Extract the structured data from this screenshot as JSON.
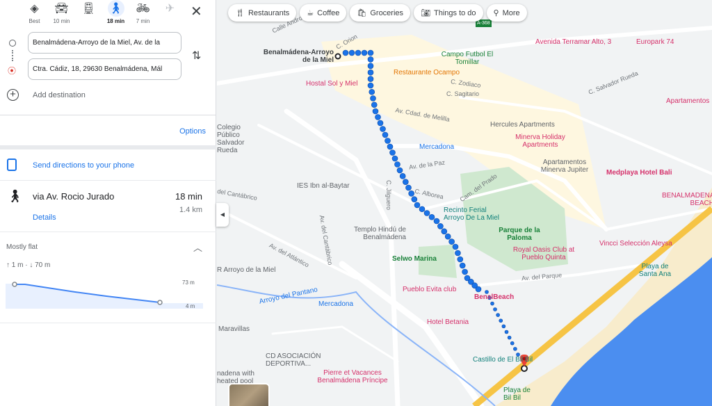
{
  "modes": [
    {
      "label": "Best",
      "icon": "directions-icon"
    },
    {
      "label": "10 min",
      "icon": "car-icon"
    },
    {
      "label": "",
      "icon": "transit-icon"
    },
    {
      "label": "18 min",
      "icon": "walk-icon",
      "active": true
    },
    {
      "label": "7 min",
      "icon": "bike-icon"
    },
    {
      "label": "",
      "icon": "flight-icon"
    }
  ],
  "origin": "Benalmádena-Arroyo de la Miel, Av. de la",
  "destination": "Ctra. Cádiz, 18, 29630 Benalmádena, Mál",
  "add_destination": "Add destination",
  "options": "Options",
  "send_phone": "Send directions to your phone",
  "route": {
    "via": "via Av. Rocio Jurado",
    "duration": "18 min",
    "distance": "1.4 km",
    "details": "Details"
  },
  "elevation": {
    "summary": "Mostly flat",
    "gain": "↑ 1 m · ↓ 70 m",
    "max": "73 m",
    "min": "4 m"
  },
  "chips": [
    {
      "label": "Restaurants",
      "icon": "fork-knife-icon"
    },
    {
      "label": "Coffee",
      "icon": "coffee-icon"
    },
    {
      "label": "Groceries",
      "icon": "groceries-icon"
    },
    {
      "label": "Things to do",
      "icon": "camera-icon"
    },
    {
      "label": "More",
      "icon": "search-icon"
    }
  ],
  "map_labels": {
    "start": "Benalmádena-Arroyo de la Miel",
    "hostal": "Hostal Sol y Miel",
    "ocampo": "Restaurante Ocampo",
    "campo": "Campo Futbol El Tomillar",
    "terramar": "Avenida Terramar Alto, 3",
    "europark": "Europark 74",
    "apart": "Apartamentos",
    "hercules": "Hercules Apartments",
    "minerva": "Minerva Holiday Apartments",
    "jupiter": "Apartamentos Minerva Jupiter",
    "bali": "Medplaya Hotel Bali",
    "benbeach": "BENALMADENA BEACH",
    "mercadona1": "Mercadona",
    "colegio": "Colegio Público Salvador Rueda",
    "ies": "IES Ibn al-Baytar",
    "templo": "Templo Hindú de Benalmádena",
    "recinto": "Recinto Ferial Arroyo De La Miel",
    "parque": "Parque de la Paloma",
    "royal": "Royal Oasis Club at Pueblo Quinta",
    "vincci": "Vincci Selección Aleysa",
    "santaana": "Playa de Santa Ana",
    "selwo": "Selwo Marina",
    "evita": "Pueblo Evita club",
    "benalbeach": "BenalBeach",
    "betania": "Hotel Betania",
    "castillo": "Castillo de El Bil Bil",
    "bilbil": "Playa de Bil Bil",
    "mercadona2": "Mercadona",
    "pantano": "Arroyo del Pantano",
    "maravillas": "Maravillas",
    "cd": "CD ASOCIACIÓN DEPORTIVA...",
    "pierre": "Pierre et Vacances Benalmádena Príncipe",
    "arroyo": "R Arroyo de la Miel",
    "heated": "nadena with heated pool",
    "r_orion": "C. Orion",
    "r_zodiaco": "C. Zodiaco",
    "r_sagitario": "C. Sagitario",
    "r_salvador": "C. Salvador Rueda",
    "r_melilla": "Av. Cdad. de Melilla",
    "r_paz": "Av. de la Paz",
    "r_alborea": "C. Alborea",
    "r_jilguero": "C. Jilguero",
    "r_prado": "Cam. del Prado",
    "r_parque": "Av. del Parque",
    "r_cantabrico": "Av. del Cantábrico",
    "r_cantabrico2": "del Cantábrico",
    "r_atlantico": "Av. del Atlántico",
    "r_andro": "Calle Andro",
    "r_a368": "A-368"
  },
  "colors": {
    "accent": "#1a73e8",
    "route": "#1a73e8",
    "hotel": "#d5306a",
    "park": "#c8e6c9",
    "water": "#4b8ef0"
  }
}
